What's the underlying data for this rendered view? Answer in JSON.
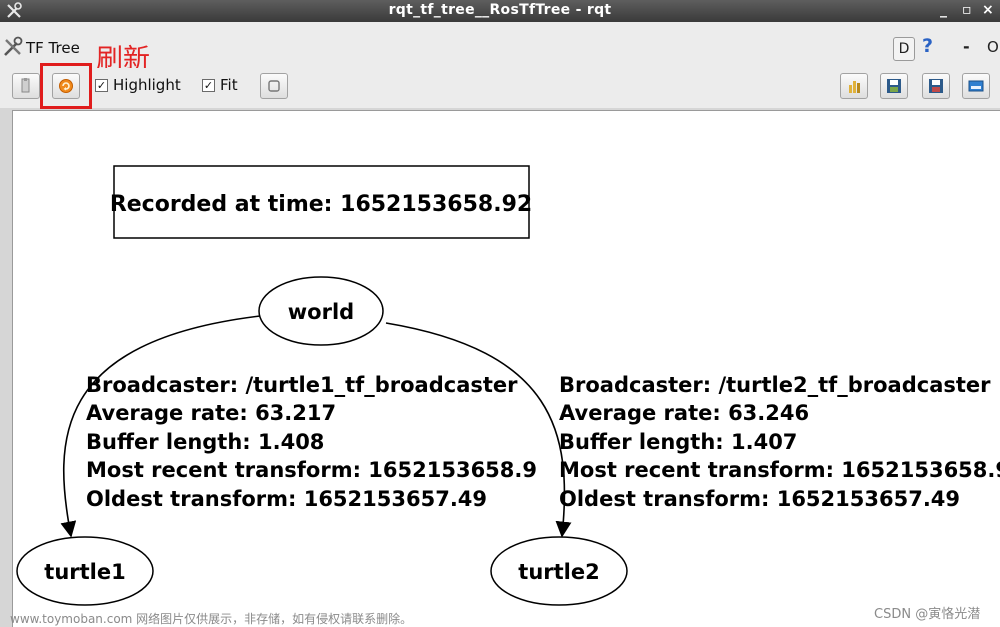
{
  "window": {
    "title": "rqt_tf_tree__RosTfTree - rqt",
    "minimize_label": "_",
    "close_label": "◘"
  },
  "plugin": {
    "title": "TF Tree",
    "d_label": "D",
    "help_label": "?",
    "dash_label": "-",
    "o_label": "O"
  },
  "annotation": {
    "text": "刷新",
    "color": "#e32424"
  },
  "toolbar": {
    "highlight_label": "Highlight",
    "highlight_checked": true,
    "fit_label": "Fit",
    "fit_checked": true,
    "check_mark": "✓"
  },
  "graph": {
    "recorded": "Recorded at time: 1652153658.92",
    "root": "world",
    "left_child": "turtle1",
    "right_child": "turtle2",
    "left_edge": [
      "Broadcaster: /turtle1_tf_broadcaster",
      "Average rate: 63.217",
      "Buffer length: 1.408",
      "Most recent transform: 1652153658.9",
      "Oldest transform: 1652153657.49"
    ],
    "right_edge": [
      "Broadcaster: /turtle2_tf_broadcaster",
      "Average rate: 63.246",
      "Buffer length: 1.407",
      "Most recent transform: 1652153658.9",
      "Oldest transform: 1652153657.49"
    ]
  },
  "watermark": {
    "left": "www.toymoban.com 网络图片仅供展示，非存储，如有侵权请联系删除。",
    "right": "CSDN @寅恪光潜"
  }
}
